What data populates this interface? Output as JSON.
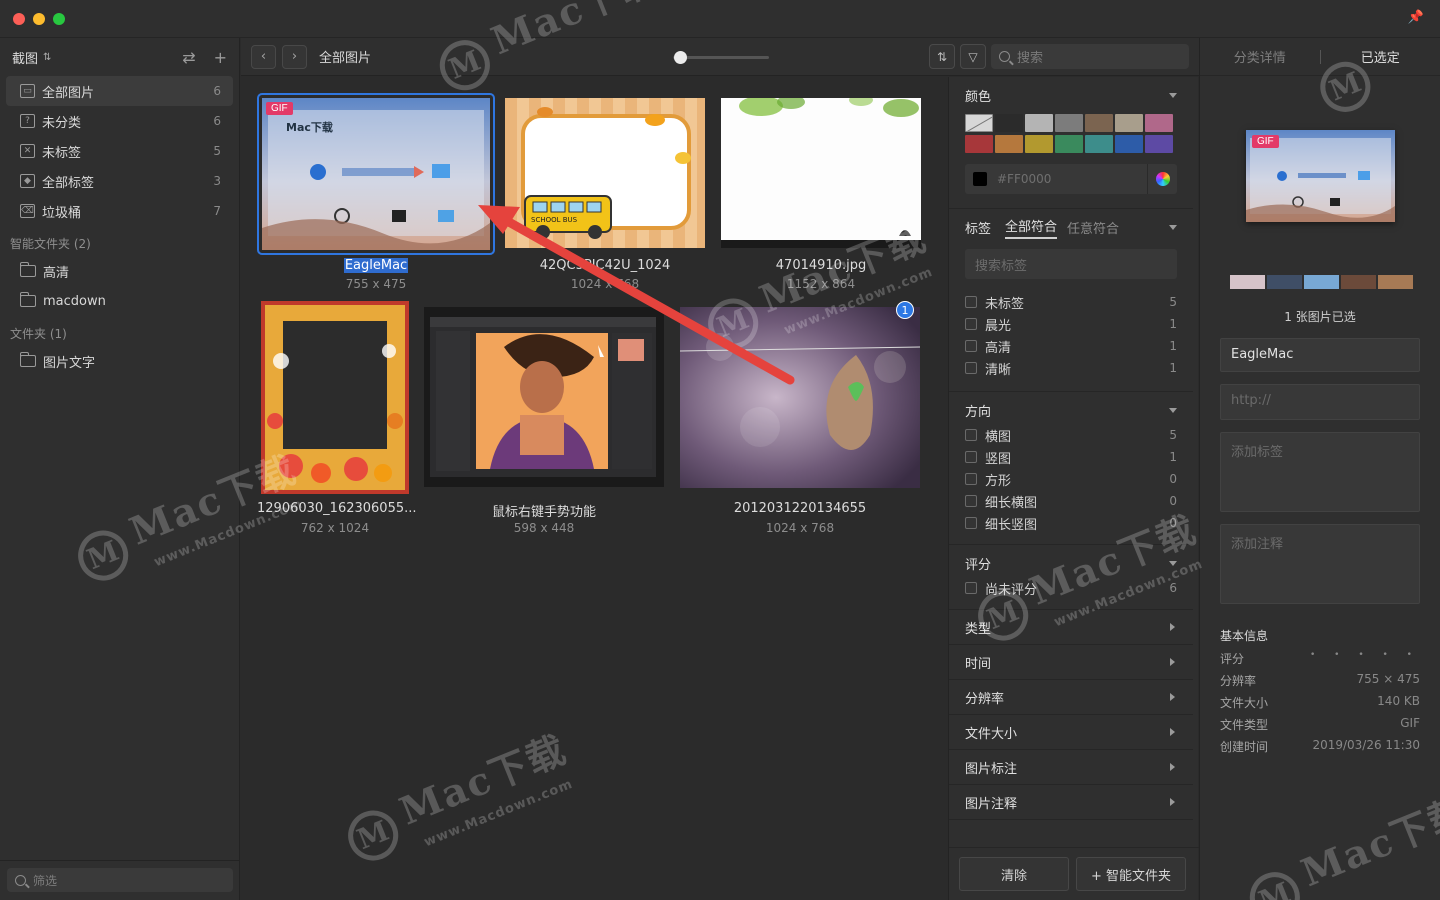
{
  "sidebar": {
    "library_title": "截图",
    "items": [
      {
        "label": "全部图片",
        "count": "6"
      },
      {
        "label": "未分类",
        "count": "6"
      },
      {
        "label": "未标签",
        "count": "5"
      },
      {
        "label": "全部标签",
        "count": "3"
      },
      {
        "label": "垃圾桶",
        "count": "7"
      }
    ],
    "smart_section": "智能文件夹 (2)",
    "smart_folders": [
      "高清",
      "macdown"
    ],
    "folder_section": "文件夹 (1)",
    "folders": [
      "图片文字"
    ],
    "filter_placeholder": "筛选"
  },
  "toolbar": {
    "breadcrumb": "全部图片",
    "search_placeholder": "搜索",
    "zoom": 0.05
  },
  "grid": {
    "items": [
      {
        "name": "EagleMac",
        "dims": "755 x 475",
        "gif": "GIF",
        "selected": true
      },
      {
        "name": "42QC5PIC42U_1024",
        "dims": "1024 x 768"
      },
      {
        "name": "47014910.jpg",
        "dims": "1152 x 864"
      },
      {
        "name": "12906030_162306055...",
        "dims": "762 x 1024"
      },
      {
        "name": "鼠标右键手势功能",
        "dims": "598 x 448"
      },
      {
        "name": "2012031220134655",
        "dims": "1024 x 768",
        "badge": "1"
      }
    ]
  },
  "filters": {
    "color_title": "颜色",
    "color_swatches": [
      "none",
      "#2b2b2b",
      "#b4b4b4",
      "#7c7c7c",
      "#7b6450",
      "#a89e8c",
      "#b0688a",
      "#a7373a",
      "#b5783d",
      "#b2992f",
      "#3a8a5d",
      "#3d8d8b",
      "#2d5ca8",
      "#5d4aa4"
    ],
    "hex_value": "#FF0000",
    "tags_title": "标签",
    "tags_tab_all": "全部符合",
    "tags_tab_any": "任意符合",
    "tags_search_placeholder": "搜索标签",
    "tags": [
      {
        "label": "未标签",
        "count": "5"
      },
      {
        "label": "晨光",
        "count": "1"
      },
      {
        "label": "高清",
        "count": "1"
      },
      {
        "label": "清晰",
        "count": "1"
      }
    ],
    "orientation_title": "方向",
    "orientations": [
      {
        "label": "横图",
        "count": "5"
      },
      {
        "label": "竖图",
        "count": "1"
      },
      {
        "label": "方形",
        "count": "0"
      },
      {
        "label": "细长横图",
        "count": "0"
      },
      {
        "label": "细长竖图",
        "count": "0"
      }
    ],
    "rating_title": "评分",
    "ratings": [
      {
        "label": "尚未评分",
        "count": "6"
      }
    ],
    "collapsed": [
      "类型",
      "时间",
      "分辨率",
      "文件大小",
      "图片标注",
      "图片注释"
    ],
    "clear_label": "清除",
    "smart_folder_label": "+ 智能文件夹"
  },
  "inspector": {
    "tab_category": "分类详情",
    "tab_selected": "已选定",
    "gif": "GIF",
    "palette": [
      "#d6c3c9",
      "#3f4e66",
      "#78a8d4",
      "#6b4a3a",
      "#a77a55"
    ],
    "selected_count": "1 张图片已选",
    "name_value": "EagleMac",
    "url_placeholder": "http://",
    "tags_placeholder": "添加标签",
    "notes_placeholder": "添加注释",
    "info_title": "基本信息",
    "info": [
      {
        "key": "评分",
        "value": "• • • • •"
      },
      {
        "key": "分辨率",
        "value": "755 × 475"
      },
      {
        "key": "文件大小",
        "value": "140 KB"
      },
      {
        "key": "文件类型",
        "value": "GIF"
      },
      {
        "key": "创建时间",
        "value": "2019/03/26 11:30"
      }
    ]
  },
  "watermark": {
    "brand": "Mac下载",
    "site": "www.Macdown.com"
  }
}
